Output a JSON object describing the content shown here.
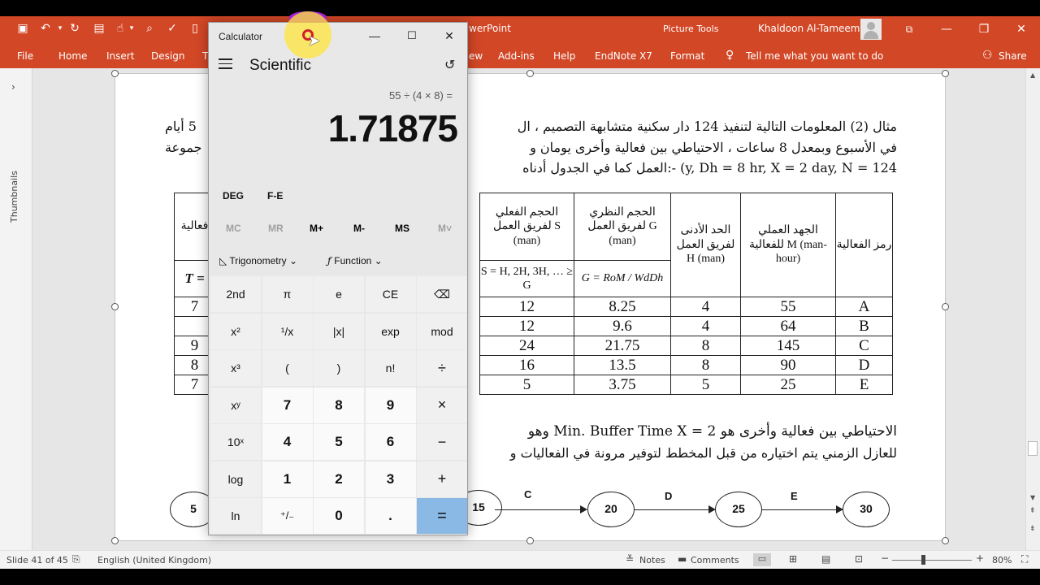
{
  "app": {
    "title_partial": "werPoint",
    "context_tab_group": "Picture Tools",
    "user_name": "Khaldoon Al-Tameemi",
    "tabs": [
      "File",
      "Home",
      "Insert",
      "Design",
      "T",
      "ew",
      "Add-ins",
      "Help",
      "EndNote X7",
      "Format"
    ],
    "tell_me": "Tell me what you want to do",
    "share": "Share",
    "thumbnails_label": "Thumbnails",
    "brand_color": "#d24726"
  },
  "status": {
    "slide": "Slide 41 of 45",
    "language": "English (United Kingdom)",
    "notes": "Notes",
    "comments": "Comments",
    "zoom": "80%"
  },
  "slide": {
    "para1_line1": "مثال (2) المعلومات التالية لتنفيذ 124 دار سكنية متشابهة التصميم ، ال",
    "para1_line1_right": "5 أيام",
    "para1_line2": "في الأسبوع وبمعدل 8 ساعات ، الاحتياطي بين فعالية وأخرى يومان و",
    "para1_line2_right": "جموعة",
    "para1_line3": "العمل كما في الجدول أدناه:- (y, Dh = 8 hr, X = 2 day, N = 124",
    "table": {
      "headers": [
        "رمز الفعالية",
        "الجهد العملي للفعالية M (man-hour)",
        "الحد الأدنى لفريق العمل H (man)",
        "الحجم النظري لفريق العمل G (man)",
        "الحجم الفعلي لفريق العمل S (man)",
        "فعالية"
      ],
      "formula_s": "S = H, 2H, 3H, … ≥ G",
      "formula_g": "G = RoM / WdDh",
      "formula_t": "T =",
      "rows": [
        [
          "A",
          "55",
          "4",
          "8.25",
          "12",
          "7"
        ],
        [
          "B",
          "64",
          "4",
          "9.6",
          "12",
          ""
        ],
        [
          "C",
          "145",
          "8",
          "21.75",
          "24",
          "9"
        ],
        [
          "D",
          "90",
          "8",
          "13.5",
          "16",
          "8"
        ],
        [
          "E",
          "25",
          "5",
          "3.75",
          "5",
          "7"
        ]
      ]
    },
    "para2_line1": "الاحتياطي بين فعالية وأخرى هو Min. Buffer Time X = 2 وهو",
    "para2_line2": "للعازل الزمني يتم اختياره من قبل المخطط لتوفير مرونة في الفعاليات و",
    "network_nodes": [
      "5",
      "15",
      "20",
      "25",
      "30"
    ],
    "network_labels": [
      "C",
      "D",
      "E"
    ]
  },
  "calculator": {
    "title": "Calculator",
    "mode": "Scientific",
    "expression": "55 ÷ (4 × 8) =",
    "result": "1.71875",
    "deg": "DEG",
    "fe": "F-E",
    "memory": [
      "MC",
      "MR",
      "M+",
      "M-",
      "MS",
      "M˅"
    ],
    "trig": "Trigonometry",
    "func": "Function",
    "keys": [
      [
        "2nd",
        "π",
        "e",
        "CE",
        "⌫"
      ],
      [
        "x²",
        "¹/x",
        "|x|",
        "exp",
        "mod"
      ],
      [
        "x³",
        "(",
        ")",
        "n!",
        "÷"
      ],
      [
        "xʸ",
        "7",
        "8",
        "9",
        "×"
      ],
      [
        "10ˣ",
        "4",
        "5",
        "6",
        "−"
      ],
      [
        "log",
        "1",
        "2",
        "3",
        "+"
      ],
      [
        "ln",
        "⁺/₋",
        "0",
        ".",
        "="
      ]
    ]
  }
}
